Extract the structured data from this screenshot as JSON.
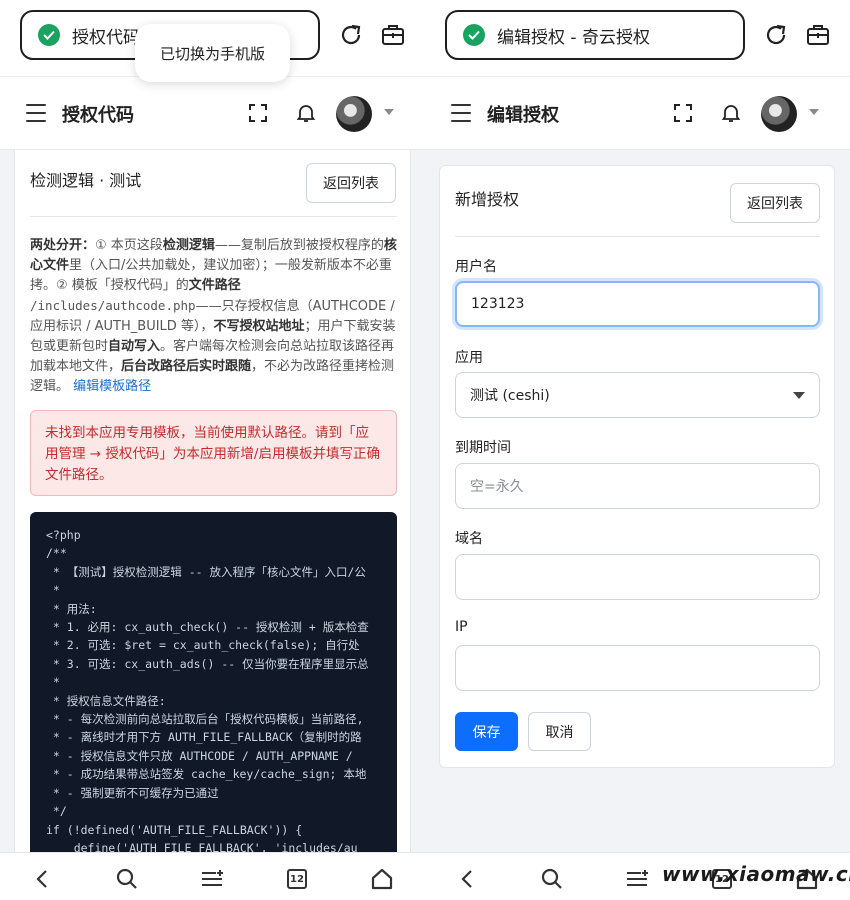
{
  "left": {
    "browser": {
      "url_text": "授权代码",
      "toast": "已切换为手机版"
    },
    "header": {
      "title": "授权代码"
    },
    "card": {
      "title": "检测逻辑 · 测试",
      "back_label": "返回列表",
      "info": {
        "s1": "两处分开：",
        "s2": "① 本页这段",
        "s3": "检测逻辑",
        "s4": "——复制后放到被授权程序的",
        "s5": "核心文件",
        "s6": "里（入口/公共加载处，建议加密）；一般发新版本不必重拷。② 模板「授权代码」的",
        "s7": "文件路径",
        "s8": "/includes/authcode.php",
        "s9": "——只存授权信息（AUTHCODE / 应用标识 / AUTH_BUILD 等），",
        "s10": "不写授权站地址",
        "s11": "；用户下载安装包或更新包时",
        "s12": "自动写入",
        "s13": "。客户端每次检测会向总站拉取该路径再加载本地文件，",
        "s14": "后台改路径后实时跟随",
        "s15": "，不必为改路径重拷检测逻辑。",
        "link": "编辑模板路径"
      },
      "alert": "未找到本应用专用模板，当前使用默认路径。请到「应用管理 → 授权代码」为本应用新增/启用模板并填写正确文件路径。",
      "code_lines": [
        "<?php",
        "/**",
        " * 【测试】授权检测逻辑 -- 放入程序「核心文件」入口/公",
        " *",
        " * 用法:",
        " * 1. 必用: cx_auth_check() -- 授权检测 + 版本检查",
        " * 2. 可选: $ret = cx_auth_check(false); 自行处",
        " * 3. 可选: cx_auth_ads() -- 仅当你要在程序里显示总",
        " *",
        " * 授权信息文件路径:",
        " * - 每次检测前向总站拉取后台「授权代码模板」当前路径,",
        " * - 离线时才用下方 AUTH_FILE_FALLBACK（复制时的路",
        " * - 授权信息文件只放 AUTHCODE / AUTH_APPNAME / ",
        " * - 成功结果带总站签发 cache_key/cache_sign; 本地",
        " * - 强制更新不可缓存为已通过",
        " */",
        "if (!defined('AUTH_FILE_FALLBACK')) {",
        "    define('AUTH_FILE_FALLBACK', 'includes/au"
      ]
    }
  },
  "right": {
    "browser": {
      "url_text": "编辑授权 - 奇云授权"
    },
    "header": {
      "title": "编辑授权"
    },
    "card": {
      "title": "新增授权",
      "back_label": "返回列表",
      "username_label": "用户名",
      "username_value": "123123",
      "app_label": "应用",
      "app_value": "测试 (ceshi)",
      "expire_label": "到期时间",
      "expire_placeholder": "空=永久",
      "domain_label": "域名",
      "domain_value": "",
      "ip_label": "IP",
      "ip_value": "",
      "save_label": "保存",
      "cancel_label": "取消"
    }
  },
  "bottom_nav": {
    "tab_count": "12"
  },
  "watermark": "www.xiaomaw.cn",
  "colors": {
    "primary": "#0d6efd",
    "danger": "#c42b2b",
    "code_bg": "#111827",
    "secure": "#1aa260"
  }
}
